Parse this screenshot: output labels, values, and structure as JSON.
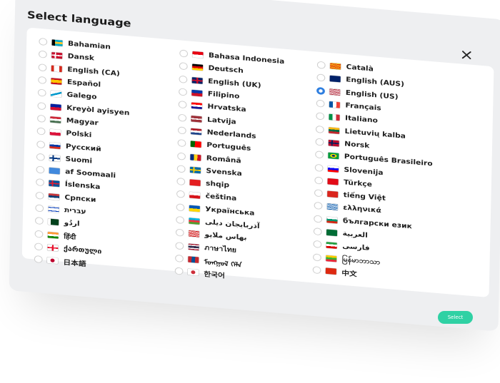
{
  "dialog": {
    "title": "Select language",
    "select_label": "Select"
  },
  "colors": {
    "accent": "#2fd1a4",
    "radio_selected": "#2f7fe0"
  },
  "selected": "English (US)",
  "columns": [
    [
      {
        "label": "Bahamian",
        "flag": "bahamas-flag"
      },
      {
        "label": "Dansk",
        "flag": "denmark-flag"
      },
      {
        "label": "English (CA)",
        "flag": "canada-flag"
      },
      {
        "label": "Español",
        "flag": "spain-flag"
      },
      {
        "label": "Galego",
        "flag": "galicia-flag"
      },
      {
        "label": "Kreyòl ayisyen",
        "flag": "haiti-flag"
      },
      {
        "label": "Magyar",
        "flag": "hungary-flag"
      },
      {
        "label": "Polski",
        "flag": "poland-flag"
      },
      {
        "label": "Русский",
        "flag": "russia-flag"
      },
      {
        "label": "Suomi",
        "flag": "finland-flag"
      },
      {
        "label": "af Soomaali",
        "flag": "somalia-flag"
      },
      {
        "label": "Íslenska",
        "flag": "iceland-flag"
      },
      {
        "label": "Српски",
        "flag": "serbia-flag"
      },
      {
        "label": "עברית",
        "flag": "israel-flag"
      },
      {
        "label": "اردُو",
        "flag": "pakistan-flag"
      },
      {
        "label": "हिंदी",
        "flag": "india-flag"
      },
      {
        "label": "ქართული",
        "flag": "georgia-flag"
      },
      {
        "label": "日本語",
        "flag": "japan-flag"
      }
    ],
    [
      {
        "label": "Bahasa Indonesia",
        "flag": "indonesia-flag"
      },
      {
        "label": "Deutsch",
        "flag": "germany-flag"
      },
      {
        "label": "English (UK)",
        "flag": "uk-flag"
      },
      {
        "label": "Filipino",
        "flag": "philippines-flag"
      },
      {
        "label": "Hrvatska",
        "flag": "croatia-flag"
      },
      {
        "label": "Latvija",
        "flag": "latvia-flag"
      },
      {
        "label": "Nederlands",
        "flag": "netherlands-flag"
      },
      {
        "label": "Português",
        "flag": "portugal-flag"
      },
      {
        "label": "Română",
        "flag": "romania-flag"
      },
      {
        "label": "Svenska",
        "flag": "sweden-flag"
      },
      {
        "label": "shqip",
        "flag": "albania-flag"
      },
      {
        "label": "čeština",
        "flag": "czech-flag"
      },
      {
        "label": "Українська",
        "flag": "ukraine-flag"
      },
      {
        "label": "آذربایجان دیلی",
        "flag": "azerbaijan-flag"
      },
      {
        "label": "بهاس ملايو",
        "flag": "malaysia-flag"
      },
      {
        "label": "ภาษาไทย",
        "flag": "thailand-flag"
      },
      {
        "label": "ᠮᠣᠩᠭᠣᠯ ᠬᠡᠯᠡ",
        "flag": "mongolia-flag"
      },
      {
        "label": "한국어",
        "flag": "korea-flag"
      }
    ],
    [
      {
        "label": "Català",
        "flag": "catalonia-flag"
      },
      {
        "label": "English (AUS)",
        "flag": "australia-flag"
      },
      {
        "label": "English (US)",
        "flag": "usa-flag"
      },
      {
        "label": "Français",
        "flag": "france-flag"
      },
      {
        "label": "Italiano",
        "flag": "italy-flag"
      },
      {
        "label": "Lietuvių kalba",
        "flag": "lithuania-flag"
      },
      {
        "label": "Norsk",
        "flag": "norway-flag"
      },
      {
        "label": "Português Brasileiro",
        "flag": "brazil-flag"
      },
      {
        "label": "Slovenija",
        "flag": "slovenia-flag"
      },
      {
        "label": "Türkçe",
        "flag": "turkey-flag"
      },
      {
        "label": "tiếng Việt",
        "flag": "vietnam-flag"
      },
      {
        "label": "ελληνικά",
        "flag": "greece-flag"
      },
      {
        "label": "български език",
        "flag": "bulgaria-flag"
      },
      {
        "label": "العربية",
        "flag": "saudi-flag"
      },
      {
        "label": "فارسی",
        "flag": "iran-flag"
      },
      {
        "label": "မြန်မာဘာသာ",
        "flag": "myanmar-flag"
      },
      {
        "label": "中文",
        "flag": "china-flag"
      }
    ]
  ]
}
